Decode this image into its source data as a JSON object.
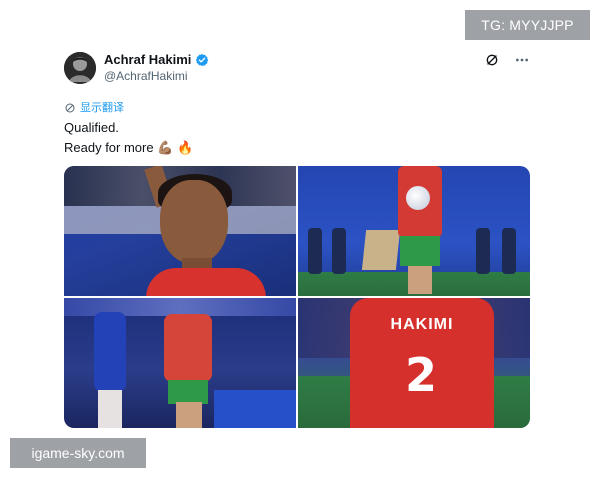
{
  "watermarks": {
    "top_right": "TG: MYYJJPP",
    "bottom_left": "igame-sky.com"
  },
  "tweet": {
    "author": {
      "display_name": "Achraf Hakimi",
      "handle": "@AchrafHakimi",
      "verified": true,
      "verified_color": "#1d9bf0"
    },
    "translate_label": "显示翻译",
    "text_lines": [
      "Qualified.",
      "Ready for more"
    ],
    "text_emojis": [
      "💪🏽",
      "🔥"
    ],
    "icons": {
      "avatar": "avatar",
      "verified": "verified-badge-icon",
      "grok": "grok-icon",
      "more": "more-options-icon",
      "translate": "translate-icon"
    },
    "media": [
      {
        "name": "media-1",
        "shirt_text": ""
      },
      {
        "name": "media-2",
        "shirt_text": ""
      },
      {
        "name": "media-3",
        "shirt_text": ""
      },
      {
        "name": "media-4",
        "shirt_text": "2",
        "shirt_name": "HAKIMI"
      }
    ]
  }
}
